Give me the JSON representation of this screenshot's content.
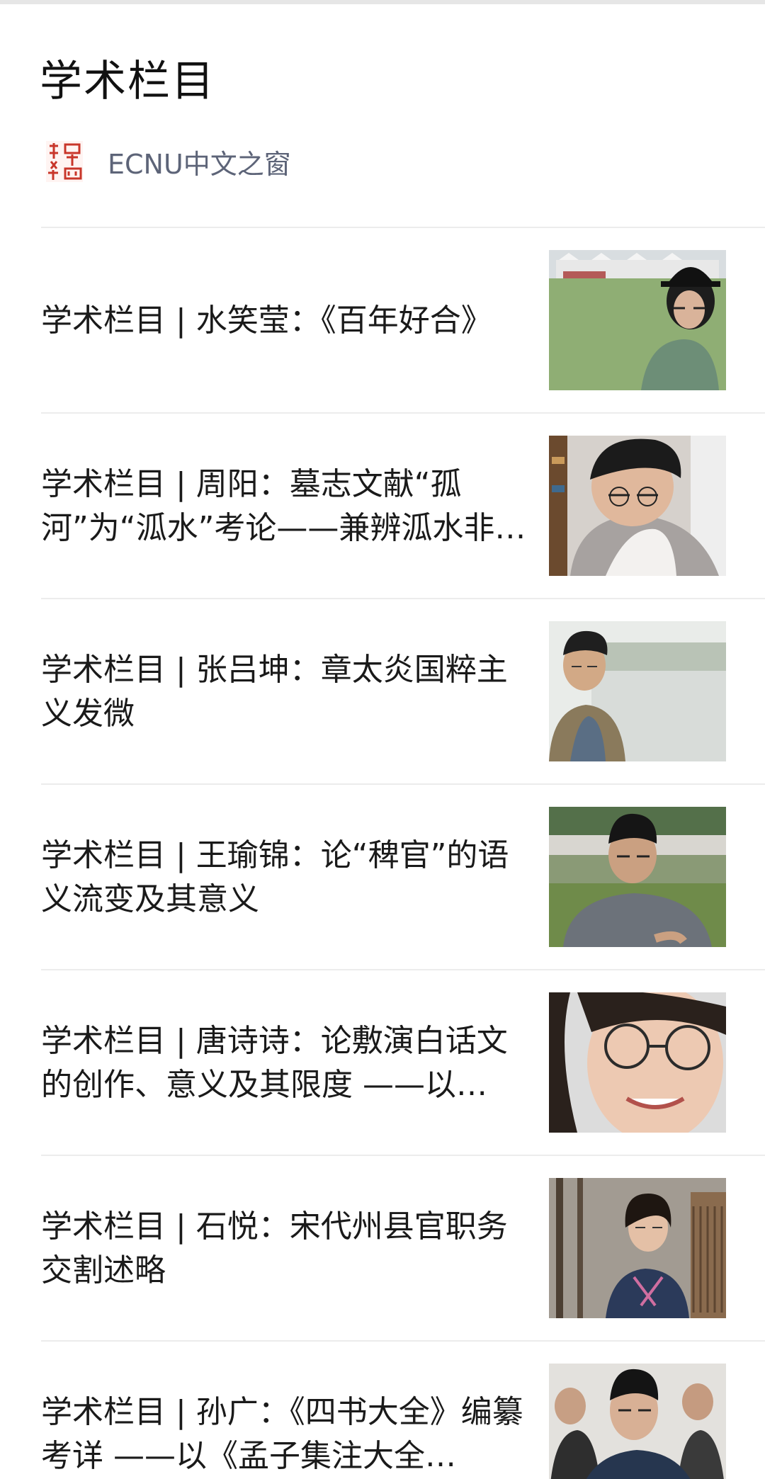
{
  "page": {
    "title": "学术栏目",
    "account": {
      "name": "ECNU中文之窗",
      "logo_icon": "seal-logo-icon"
    }
  },
  "articles": [
    {
      "title": "学术栏目 | 水笑莹：《百年好合》",
      "thumb": "woman-in-black-hat-on-lawn-photo"
    },
    {
      "title": "学术栏目 | 周阳：墓志文献“孤河”为“泒水”考论——兼辨泒水非滹…",
      "thumb": "young-man-with-glasses-looking-down-photo"
    },
    {
      "title": "学术栏目 | 张吕坤：章太炎国粹主义发微",
      "thumb": "young-man-by-lake-photo"
    },
    {
      "title": "学术栏目 | 王瑜锦：论“稗官”的语义流变及其意义",
      "thumb": "young-man-in-grey-tshirt-photo"
    },
    {
      "title": "学术栏目 | 唐诗诗：论敷演白话文的创作、意义及其限度 ——以…",
      "thumb": "smiling-woman-with-glasses-photo"
    },
    {
      "title": "学术栏目 | 石悦：宋代州县官职务交割述略",
      "thumb": "woman-among-trees-photo"
    },
    {
      "title": "学术栏目 | 孙广：《四书大全》编纂考详 ——以《孟子集注大全…",
      "thumb": "young-man-in-suit-photo"
    }
  ]
}
